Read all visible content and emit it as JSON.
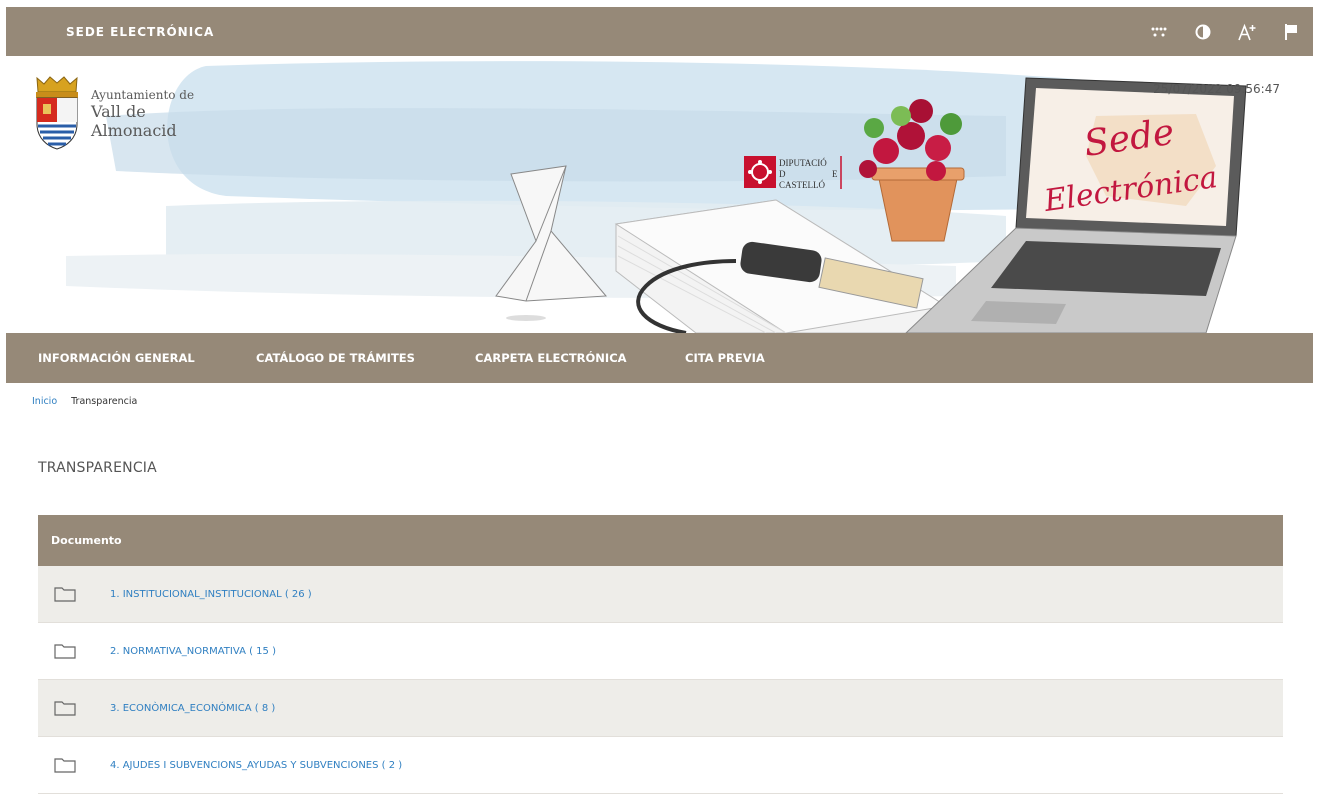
{
  "header": {
    "site_title": "SEDE ELECTRÓNICA",
    "tools": [
      {
        "icon": "dots-grid-icon"
      },
      {
        "icon": "contrast-icon"
      },
      {
        "icon": "font-size-increase-icon"
      },
      {
        "icon": "flag-icon"
      }
    ]
  },
  "banner": {
    "logo_line1": "Ayuntamiento de",
    "logo_line2": "Vall de",
    "logo_line3": "Almonacid",
    "datetime": "25/07/2022 09:56:47",
    "diputacio_line1": "DIPUTACIÓ",
    "diputacio_line2a": "D",
    "diputacio_line2b": "E",
    "diputacio_line3": "CASTELLÓ",
    "screen_line1": "Sede",
    "screen_line2": "Electrónica"
  },
  "nav": {
    "items": [
      {
        "label": "INFORMACIÓN GENERAL"
      },
      {
        "label": "CATÁLOGO DE TRÁMITES"
      },
      {
        "label": "CARPETA ELECTRÓNICA"
      },
      {
        "label": "CITA PREVIA"
      }
    ]
  },
  "breadcrumb": {
    "home": "Inicio",
    "current": "Transparencia"
  },
  "page": {
    "title": "TRANSPARENCIA"
  },
  "table": {
    "header": "Documento",
    "rows": [
      {
        "label": "1. INSTITUCIONAL_INSTITUCIONAL ( 26 )"
      },
      {
        "label": "2. NORMATIVA_NORMATIVA ( 15 )"
      },
      {
        "label": "3. ECONÒMICA_ECONÓMICA ( 8 )"
      },
      {
        "label": "4. AJUDES I SUBVENCIONS_AYUDAS Y SUBVENCIONES ( 2 )"
      }
    ]
  },
  "colors": {
    "brand_brown": "#968978",
    "link_blue": "#2f7fc1",
    "row_alt": "#eeede9"
  }
}
